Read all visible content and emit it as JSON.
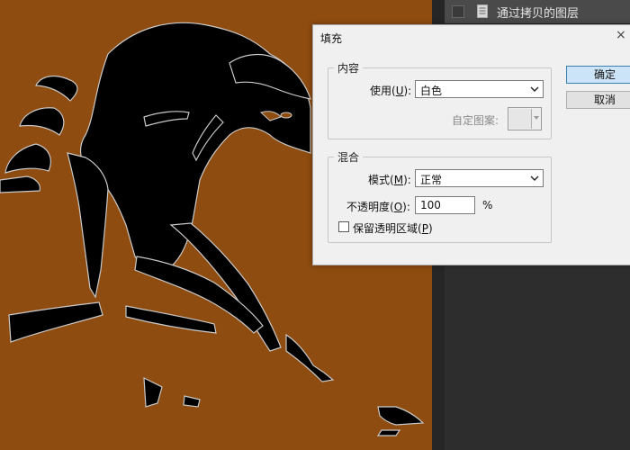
{
  "layers_panel": {
    "layer_name": "通过拷贝的图层"
  },
  "dialog": {
    "title": "填充",
    "close_glyph": "×",
    "contents_group": {
      "legend": "内容",
      "use_label": "使用",
      "use_shortcut": "U",
      "use_value": "白色",
      "custom_pattern_label": "自定图案:"
    },
    "blending_group": {
      "legend": "混合",
      "mode_label": "模式",
      "mode_shortcut": "M",
      "mode_value": "正常",
      "opacity_label": "不透明度",
      "opacity_shortcut": "O",
      "opacity_value": "100",
      "opacity_unit": "%",
      "preserve_label": "保留透明区域",
      "preserve_shortcut": "P",
      "preserve_checked": false
    },
    "ok_label": "确定",
    "cancel_label": "取消"
  },
  "colors": {
    "canvas_bg": "#8e4c10",
    "silhouette": "#000000",
    "panel_bg": "#262626",
    "primary_button": "#cce4f7"
  }
}
